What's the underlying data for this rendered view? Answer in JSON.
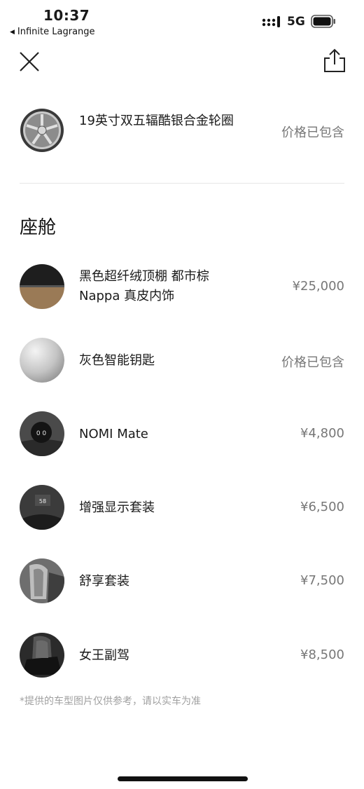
{
  "status_bar": {
    "time": "10:37",
    "back_app": "Infinite Lagrange",
    "network": "5G"
  },
  "nav": {
    "close_icon": "close-icon",
    "share_icon": "share-icon"
  },
  "wheel": {
    "label": "19英寸双五辐酷银合金轮圈",
    "price": "价格已包含"
  },
  "cabin": {
    "title": "座舱",
    "items": [
      {
        "label": "黑色超纤绒顶棚 都市棕 Nappa 真皮内饰",
        "price": "¥25,000"
      },
      {
        "label": "灰色智能钥匙",
        "price": "价格已包含"
      },
      {
        "label": "NOMI Mate",
        "price": "¥4,800"
      },
      {
        "label": "增强显示套装",
        "price": "¥6,500"
      },
      {
        "label": "舒享套装",
        "price": "¥7,500"
      },
      {
        "label": "女王副驾",
        "price": "¥8,500"
      }
    ]
  },
  "footnote": "*提供的车型图片仅供参考，请以实车为准",
  "thumb_texts": {
    "nomi": "0 0",
    "hud": "58"
  }
}
